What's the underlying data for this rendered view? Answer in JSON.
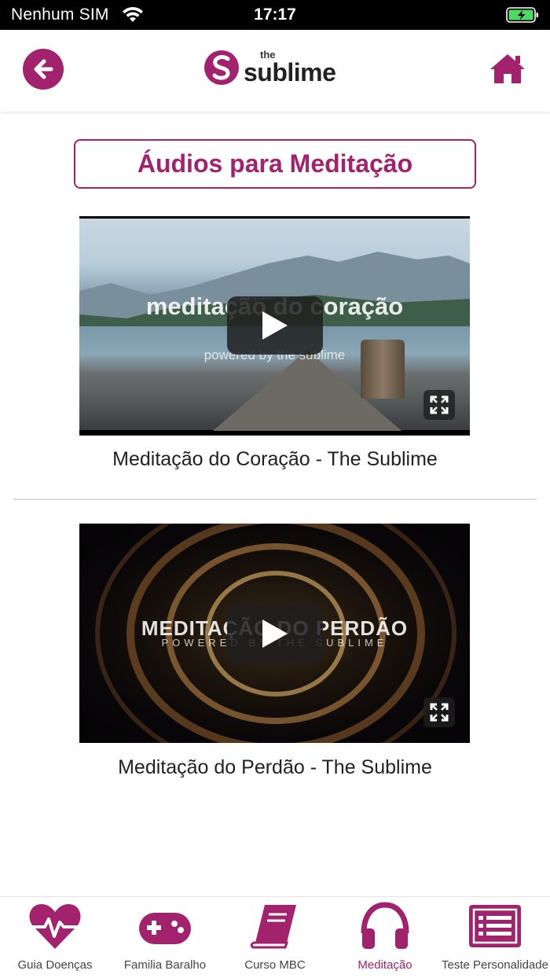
{
  "status_bar": {
    "carrier": "Nenhum SIM",
    "time": "17:17"
  },
  "header": {
    "logo_the": "the",
    "logo_word": "sublime",
    "back_icon": "back-arrow-icon",
    "home_icon": "home-icon"
  },
  "page": {
    "title": "Áudios para Meditação"
  },
  "videos": [
    {
      "overlay_title": "meditação do coração",
      "overlay_subtitle": "powered by the sublime",
      "caption": "Meditação do Coração - The Sublime"
    },
    {
      "overlay_title": "MEDITAÇÃO DO PERDÃO",
      "overlay_subtitle": "POWERED BY THE SUBLIME",
      "caption": "Meditação do Perdão - The Sublime"
    }
  ],
  "tabs": [
    {
      "label": "Guia Doenças",
      "icon": "heartbeat-icon",
      "active": false
    },
    {
      "label": "Familia Baralho",
      "icon": "gamepad-icon",
      "active": false
    },
    {
      "label": "Curso MBC",
      "icon": "book-icon",
      "active": false
    },
    {
      "label": "Meditação",
      "icon": "headphones-icon",
      "active": true
    },
    {
      "label": "Teste Personalidade",
      "icon": "list-icon",
      "active": false
    }
  ],
  "colors": {
    "brand": "#a2226e",
    "status_bar": "#000000",
    "battery": "#4cd964"
  }
}
